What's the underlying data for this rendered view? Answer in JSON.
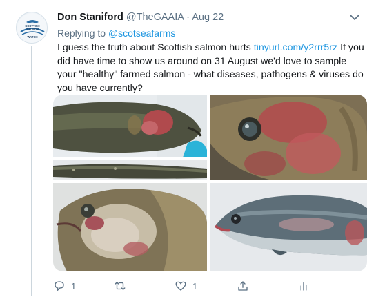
{
  "tweet": {
    "author_name": "Don Staniford",
    "handle": "@TheGAAIA",
    "separator": "·",
    "date": "Aug 22",
    "replying_prefix": "Replying to",
    "replying_to": "@scotseafarms",
    "text_before_link": "I guess the truth about Scottish salmon hurts",
    "link_text": "tinyurl.com/y2rrr5rz",
    "text_after_link": "If you did have time to show us around on 31 August we'd love to sample your \"healthy\" farmed salmon - what diseases, pathogens & viruses do you have currently?",
    "avatar_text": [
      "SCOTTISH",
      "SALMON",
      "WATCH"
    ]
  },
  "actions": {
    "reply_count": "1",
    "retweet_count": "",
    "like_count": "1"
  },
  "media": {
    "images": [
      {
        "name": "salmon-photo-1-top-left",
        "subject": "fish-head-lesion"
      },
      {
        "name": "salmon-photo-2-strip-left",
        "subject": "fish-side"
      },
      {
        "name": "salmon-photo-3-top-right",
        "subject": "fish-eye-lesion"
      },
      {
        "name": "salmon-photo-4-bottom-left",
        "subject": "fish-head-open-gill"
      },
      {
        "name": "salmon-photo-5-bottom-right",
        "subject": "fish-whole-body"
      }
    ]
  },
  "colors": {
    "text": "#14171a",
    "secondary": "#5b7083",
    "link": "#1b95e0",
    "thread_line": "#ccd6dd"
  }
}
